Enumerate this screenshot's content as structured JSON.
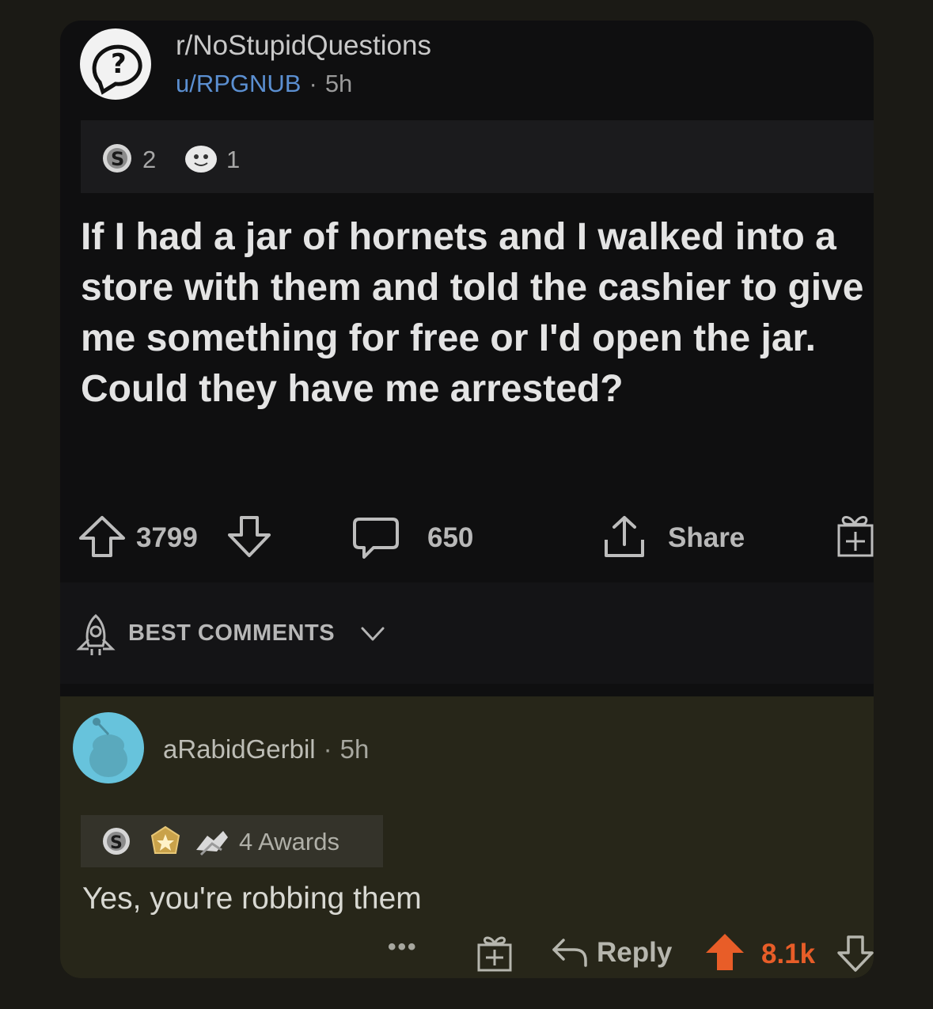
{
  "post": {
    "subreddit": "r/NoStupidQuestions",
    "author": "u/RPGNUB",
    "separator": "·",
    "age": "5h",
    "awards": [
      {
        "icon": "silver-award-icon",
        "count": "2"
      },
      {
        "icon": "wholesome-award-icon",
        "count": "1"
      }
    ],
    "title": "If I had a jar of hornets and I walked into a store with them and told the cashier to give me something for free or I'd open the jar. Could they have me arrested?",
    "score": "3799",
    "comments": "650",
    "share_label": "Share"
  },
  "sort": {
    "label": "BEST COMMENTS"
  },
  "comment": {
    "author": "aRabidGerbil",
    "separator": "·",
    "age": "5h",
    "awards_label": "4 Awards",
    "text": "Yes, you're robbing them",
    "more_label": "•••",
    "reply_label": "Reply",
    "score": "8.1k"
  },
  "colors": {
    "background": "#1b1a15",
    "card": "#0f0f10",
    "username_link": "#5b8fd1",
    "upvote_active": "#e85d28",
    "avatar": "#67c3dc"
  }
}
